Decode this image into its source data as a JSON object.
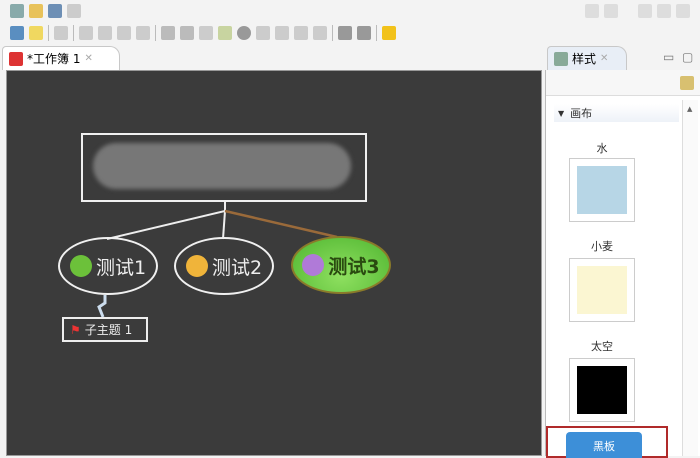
{
  "editor_tab": {
    "title": "*工作簿 1"
  },
  "panel_tab": {
    "title": "样式"
  },
  "panel": {
    "section": "画布",
    "styles": [
      {
        "name": "水",
        "color": "#b7d6e6"
      },
      {
        "name": "小麦",
        "color": "#fbf6d2"
      },
      {
        "name": "太空",
        "color": "#000000"
      }
    ],
    "selected": {
      "name": "黑板"
    }
  },
  "map": {
    "topics": [
      {
        "label": "测试1",
        "emoji_color": "#6cc13a"
      },
      {
        "label": "测试2",
        "emoji_color": "#f0b43a"
      },
      {
        "label": "测试3",
        "emoji_color": "#b07ad8"
      }
    ],
    "subtopic": {
      "label": "子主题 1"
    }
  }
}
